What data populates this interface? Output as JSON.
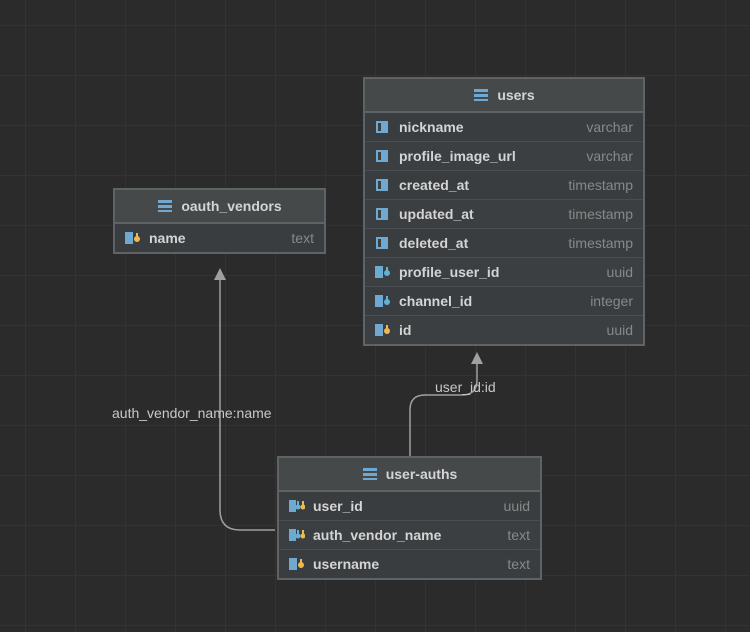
{
  "tables": {
    "oauth_vendors": {
      "title": "oauth_vendors",
      "columns": [
        {
          "name": "name",
          "type": "text",
          "icon": "pk"
        }
      ]
    },
    "users": {
      "title": "users",
      "columns": [
        {
          "name": "nickname",
          "type": "varchar",
          "icon": "col"
        },
        {
          "name": "profile_image_url",
          "type": "varchar",
          "icon": "col"
        },
        {
          "name": "created_at",
          "type": "timestamp",
          "icon": "col"
        },
        {
          "name": "updated_at",
          "type": "timestamp",
          "icon": "col"
        },
        {
          "name": "deleted_at",
          "type": "timestamp",
          "icon": "col"
        },
        {
          "name": "profile_user_id",
          "type": "uuid",
          "icon": "fk"
        },
        {
          "name": "channel_id",
          "type": "integer",
          "icon": "fk"
        },
        {
          "name": "id",
          "type": "uuid",
          "icon": "pk"
        }
      ]
    },
    "user_auths": {
      "title": "user-auths",
      "columns": [
        {
          "name": "user_id",
          "type": "uuid",
          "icon": "fkpk"
        },
        {
          "name": "auth_vendor_name",
          "type": "text",
          "icon": "fkpk"
        },
        {
          "name": "username",
          "type": "text",
          "icon": "pk"
        }
      ]
    }
  },
  "relations": {
    "r1": {
      "label": "auth_vendor_name:name"
    },
    "r2": {
      "label": "user_id:id"
    }
  }
}
